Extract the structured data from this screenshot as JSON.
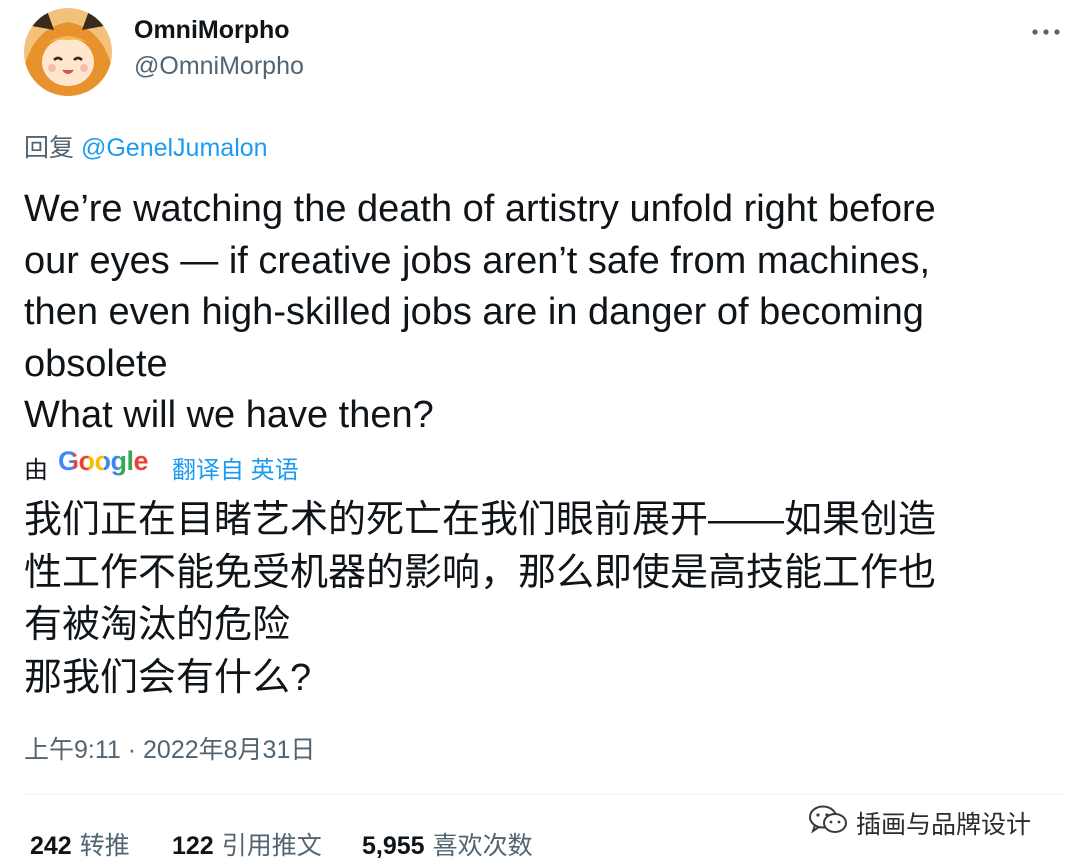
{
  "author": {
    "display_name": "OmniMorpho",
    "handle": "@OmniMorpho"
  },
  "reply": {
    "prefix": "回复",
    "mention": "@GenelJumalon"
  },
  "tweet_lines": [
    "We’re watching the death of artistry unfold right before",
    "our eyes — if creative jobs aren’t safe from machines,",
    "then even high-skilled jobs are in danger of becoming",
    "obsolete",
    "What will we have then?"
  ],
  "translation": {
    "by_label": "由",
    "provider": "Google",
    "link_label": "翻译自 英语",
    "lines": [
      "我们正在目睹艺术的死亡在我们眼前展开——如果创造",
      "性工作不能免受机器的影响，那么即使是高技能工作也",
      "有被淘汰的危险",
      "那我们会有什么?"
    ]
  },
  "timestamp": "上午9:11 · 2022年8月31日",
  "stats": {
    "retweets_count": "242",
    "retweets_label": "转推",
    "quotes_count": "122",
    "quotes_label": "引用推文",
    "likes_count": "5,955",
    "likes_label": "喜欢次数"
  },
  "watermark": "插画与品牌设计",
  "icons": {
    "more": "more-horizontal-icon",
    "watermark": "wechat-icon"
  },
  "colors": {
    "text": "#0f1419",
    "secondary": "#536471",
    "link": "#1d9bf0",
    "divider": "#eff3f4"
  }
}
